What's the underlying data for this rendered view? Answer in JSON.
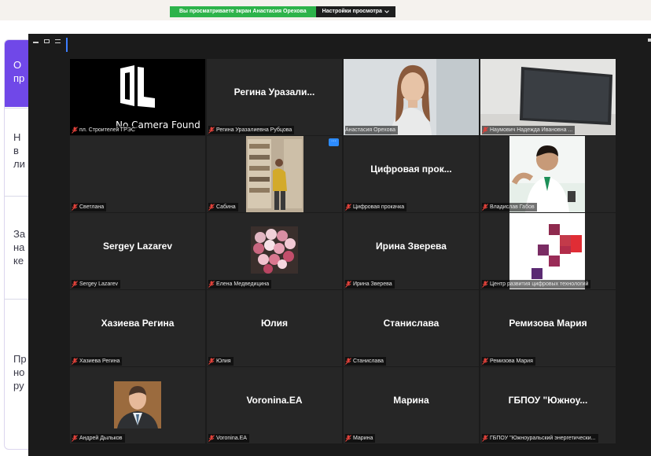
{
  "share_bar": {
    "message": "Вы просматриваете экран Анастасия Орехова",
    "settings_label": "Настройки просмотра",
    "chevron": "chevron-down-icon"
  },
  "background_page": {
    "lines": [
      "О\nпр",
      "Н\nв\nли",
      "За\nна\nке",
      "Пр\nно\nру"
    ]
  },
  "window_controls": [
    "minimize-icon",
    "maximize-icon",
    "list-view-icon",
    "gallery-view-icon"
  ],
  "colors": {
    "accent": "#2d8cff",
    "active_speaker": "#c6e04a",
    "share_green": "#2db34a",
    "muted_mic": "#e0413a"
  },
  "participants": [
    {
      "tile_text": "No Camera Found",
      "name": "пл. Строителей ГРЭС",
      "muted": true,
      "kind": "camera"
    },
    {
      "tile_text": "Регина Уразали...",
      "name": "Регина Уразалиевна Рубцова",
      "muted": true,
      "kind": "text"
    },
    {
      "tile_text": "",
      "name": "Анастасия Орехова",
      "muted": false,
      "kind": "video",
      "active": true
    },
    {
      "tile_text": "",
      "name": "Наумович Надежда Ивановна ...",
      "muted": true,
      "kind": "tv"
    },
    {
      "tile_text": "",
      "name": "Светлана",
      "muted": true,
      "kind": "blank"
    },
    {
      "tile_text": "",
      "name": "Сабина",
      "muted": true,
      "kind": "photo",
      "more": "···"
    },
    {
      "tile_text": "Цифровая прок...",
      "name": "Цифровая прокачка",
      "muted": true,
      "kind": "text"
    },
    {
      "tile_text": "",
      "name": "Владислав Габов",
      "muted": true,
      "kind": "avatar"
    },
    {
      "tile_text": "Sergey Lazarev",
      "name": "Sergey Lazarev",
      "muted": true,
      "kind": "text"
    },
    {
      "tile_text": "",
      "name": "Елена Медведицина",
      "muted": true,
      "kind": "flowers"
    },
    {
      "tile_text": "Ирина Зверева",
      "name": "Ирина Зверева",
      "muted": true,
      "kind": "text"
    },
    {
      "tile_text": "",
      "name": "Центр развития цифровых технологий",
      "muted": true,
      "kind": "logo"
    },
    {
      "tile_text": "Хазиева Регина",
      "name": "Хазиева Регина",
      "muted": true,
      "kind": "text"
    },
    {
      "tile_text": "Юлия",
      "name": "Юлия",
      "muted": true,
      "kind": "text"
    },
    {
      "tile_text": "Станислава",
      "name": "Станислава",
      "muted": true,
      "kind": "text"
    },
    {
      "tile_text": "Ремизова Мария",
      "name": "Ремизова Мария",
      "muted": true,
      "kind": "text"
    },
    {
      "tile_text": "",
      "name": "Андрей Дыльков",
      "muted": true,
      "kind": "portrait"
    },
    {
      "tile_text": "Voronina.EA",
      "name": "Voronina.EA",
      "muted": true,
      "kind": "text"
    },
    {
      "tile_text": "Марина",
      "name": "Марина",
      "muted": true,
      "kind": "text"
    },
    {
      "tile_text": "ГБПОУ \"Южноу...",
      "name": "ГБПОУ \"Южноуральский энергетически...",
      "muted": true,
      "kind": "text"
    }
  ]
}
